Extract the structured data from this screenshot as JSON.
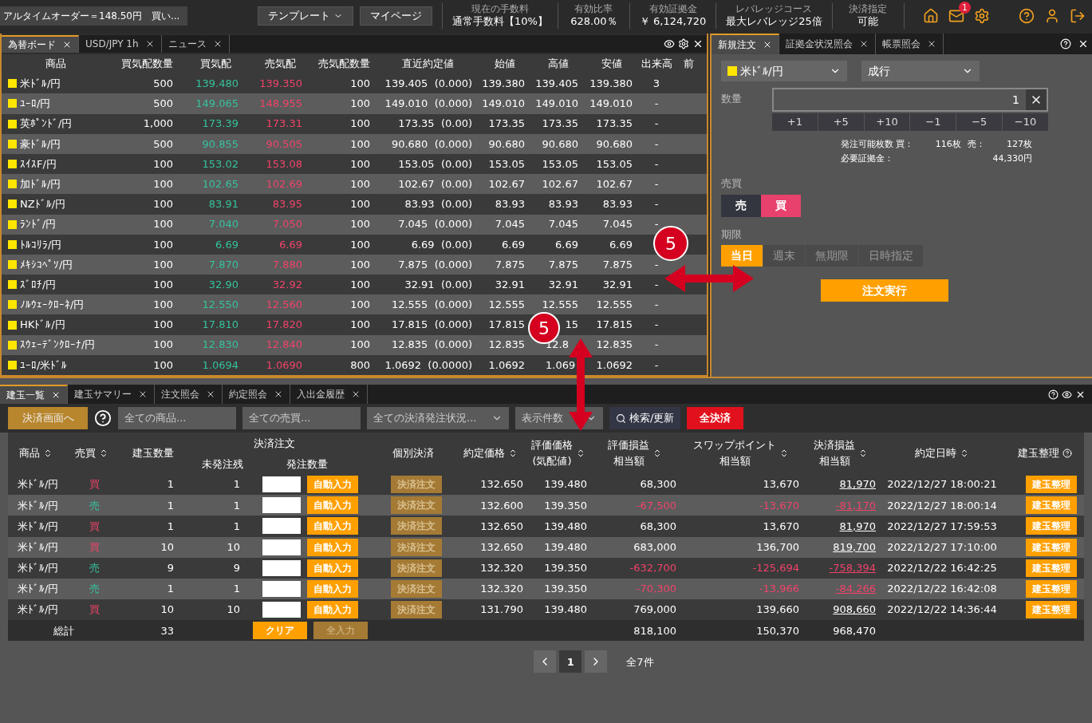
{
  "top_bar": {
    "ticker": "アルタイムオーダー＝148.50円　買い...",
    "buttons": [
      {
        "label": "テンプレート",
        "dropdown": true
      },
      {
        "label": "マイページ",
        "dropdown": false
      }
    ],
    "stats": [
      {
        "label": "現在の手数料",
        "value": "通常手数料【10%】"
      },
      {
        "label": "有効比率",
        "value": "628.00％"
      },
      {
        "label": "有効証拠金",
        "value": "￥ 6,124,720"
      },
      {
        "label": "レバレッジコース",
        "value": "最大レバレッジ25倍"
      },
      {
        "label": "決済指定",
        "value": "可能"
      }
    ],
    "mail_badge": "1"
  },
  "board": {
    "tabs": [
      {
        "label": "為替ボード",
        "selected": true
      },
      {
        "label": "USD/JPY 1h",
        "selected": false
      },
      {
        "label": "ニュース",
        "selected": false
      }
    ],
    "columns": [
      "商品",
      "買気配数量",
      "買気配",
      "売気配",
      "売気配数量",
      "直近約定値",
      "始値",
      "高値",
      "安値",
      "出来高",
      "前"
    ],
    "rows": [
      [
        "米ﾄﾞﾙ/円",
        "500",
        "139.480",
        "139.350",
        "100",
        "139.405  (0.000)",
        "139.380",
        "139.405",
        "139.380",
        "3"
      ],
      [
        "ﾕｰﾛ/円",
        "500",
        "149.065",
        "148.955",
        "100",
        "149.010  (0.000)",
        "149.010",
        "149.010",
        "149.010",
        "-"
      ],
      [
        "英ﾎﾟﾝﾄﾞ/円",
        "1,000",
        "173.39",
        "173.31",
        "100",
        "173.35  (0.00)",
        "173.35",
        "173.35",
        "173.35",
        "-"
      ],
      [
        "豪ﾄﾞﾙ/円",
        "500",
        "90.855",
        "90.505",
        "100",
        "90.680  (0.000)",
        "90.680",
        "90.680",
        "90.680",
        "-"
      ],
      [
        "ｽｲｽF/円",
        "100",
        "153.02",
        "153.08",
        "100",
        "153.05  (0.00)",
        "153.05",
        "153.05",
        "153.05",
        "-"
      ],
      [
        "加ﾄﾞﾙ/円",
        "100",
        "102.65",
        "102.69",
        "100",
        "102.67  (0.00)",
        "102.67",
        "102.67",
        "102.67",
        "-"
      ],
      [
        "NZﾄﾞﾙ/円",
        "100",
        "83.91",
        "83.95",
        "100",
        "83.93  (0.00)",
        "83.93",
        "83.93",
        "83.93",
        "-"
      ],
      [
        "ﾗﾝﾄﾞ/円",
        "100",
        "7.040",
        "7.050",
        "100",
        "7.045  (0.000)",
        "7.045",
        "7.045",
        "7.045",
        "-"
      ],
      [
        "ﾄﾙｺﾘﾗ/円",
        "100",
        "6.69",
        "6.69",
        "100",
        "6.69  (0.00)",
        "6.69",
        "6.69",
        "6.69"
      ],
      [
        "ﾒｷｼｺﾍﾟｿ/円",
        "100",
        "7.870",
        "7.880",
        "100",
        "7.875  (0.000)",
        "7.875",
        "7.875",
        "7.875",
        "-"
      ],
      [
        "ｽﾞﾛﾁ/円",
        "100",
        "32.90",
        "32.92",
        "100",
        "32.91  (0.00)",
        "32.91",
        "32.91",
        "32.91",
        "-"
      ],
      [
        "ﾉﾙｳｪｰｸﾛｰﾈ/円",
        "100",
        "12.550",
        "12.560",
        "100",
        "12.555  (0.000)",
        "12.555",
        "12.555",
        "12.555",
        "-"
      ],
      [
        "HKﾄﾞﾙ/円",
        "100",
        "17.810",
        "17.820",
        "100",
        "17.815  (0.000)",
        "17.815",
        {
          "text": "15",
          "kind": "tail"
        },
        "17.815",
        "-"
      ],
      [
        "ｽｳｪｰﾃﾞﾝｸﾛｰﾅ/円",
        "100",
        "12.830",
        "12.840",
        "100",
        "12.835  (0.000)",
        "12.835",
        {
          "text": "12.8",
          "kind": "head"
        },
        "12.835",
        "-"
      ],
      [
        "ﾕｰﾛ/米ﾄﾞﾙ",
        "100",
        "1.0694",
        "1.0690",
        "800",
        "1.0692  (0.0000)",
        "1.0692",
        {
          "text": "1.069",
          "kind": "head"
        },
        "1.0692",
        "-"
      ]
    ]
  },
  "order": {
    "tabs": [
      {
        "label": "新規注文",
        "selected": true
      },
      {
        "label": "証拠金状況照会",
        "selected": false
      },
      {
        "label": "帳票照会",
        "selected": false
      }
    ],
    "pair": "米ﾄﾞﾙ/円",
    "order_type": "成行",
    "quantity_label": "数量",
    "quantity": "1",
    "steps": [
      "+1",
      "+5",
      "+10",
      "−1",
      "−5",
      "−10"
    ],
    "info": [
      {
        "label": "発注可能枚数 買：",
        "value": "116枚",
        "label2": "売：",
        "value2": "127枚"
      },
      {
        "label": "必要証拠金：",
        "value": "44,330円"
      }
    ],
    "side_label": "売買",
    "sides": [
      {
        "label": "売",
        "selected": false,
        "kind": "sell"
      },
      {
        "label": "買",
        "selected": true,
        "kind": "buy"
      }
    ],
    "term_label": "期限",
    "terms": [
      {
        "label": "当日",
        "selected": true
      },
      {
        "label": "週末",
        "selected": false
      },
      {
        "label": "無期限",
        "selected": false
      },
      {
        "label": "日時指定",
        "selected": false
      }
    ],
    "submit": "注文実行"
  },
  "positions": {
    "tabs": [
      {
        "label": "建玉一覧",
        "selected": true
      },
      {
        "label": "建玉サマリー",
        "selected": false
      },
      {
        "label": "注文照会",
        "selected": false
      },
      {
        "label": "約定照会",
        "selected": false
      },
      {
        "label": "入出金履歴",
        "selected": false
      }
    ],
    "settle_button": "決済画面へ",
    "filters": [
      {
        "placeholder": "全ての商品...",
        "dropdown": false
      },
      {
        "placeholder": "全ての売買...",
        "dropdown": false
      },
      {
        "placeholder": "全ての決済発注状況...",
        "dropdown": true
      },
      {
        "placeholder": "表示件数",
        "dropdown": true
      }
    ],
    "search_button": "検索/更新",
    "close_all": "全決済",
    "group_header": "決済注文",
    "columns": [
      {
        "label": "商品",
        "sortable": true
      },
      {
        "label": "売買",
        "sortable": true
      },
      {
        "label": "建玉数量",
        "sortable": false
      },
      {
        "label": "未発注残",
        "sortable": false
      },
      {
        "label": "発注数量",
        "sortable": false
      },
      {
        "label": "個別決済",
        "sortable": false
      },
      {
        "label": "約定価格",
        "sortable": true
      },
      {
        "label": [
          "評価価格",
          "(気配値)"
        ],
        "sortable": true
      },
      {
        "label": [
          "評価損益",
          "相当額"
        ],
        "sortable": true
      },
      {
        "label": [
          "スワップポイント",
          "相当額"
        ],
        "sortable": true
      },
      {
        "label": [
          "決済損益",
          "相当額"
        ],
        "sortable": true
      },
      {
        "label": "約定日時",
        "sortable": true
      },
      {
        "label": "建玉整理",
        "sortable": false,
        "help": true
      }
    ],
    "rows": [
      {
        "product": "米ﾄﾞﾙ/円",
        "side": "買",
        "kind": "buy",
        "qty": "1",
        "unfilled": "1",
        "auto": "自動入力",
        "settle": "決済注文",
        "settle_disabled": true,
        "price": "132.650",
        "eval": "139.480",
        "pnl": "68,300",
        "swap": "13,670",
        "realized": "81,970",
        "loss": false,
        "date": "2022/12/27 18:00:21",
        "action": "建玉整理"
      },
      {
        "product": "米ﾄﾞﾙ/円",
        "side": "売",
        "kind": "sell",
        "qty": "1",
        "unfilled": "1",
        "auto": "自動入力",
        "settle": "決済注文",
        "settle_disabled": true,
        "price": "132.600",
        "eval": "139.350",
        "pnl": "-67,500",
        "swap": "-13,670",
        "realized": "-81,170",
        "loss": true,
        "date": "2022/12/27 18:00:14",
        "action": "建玉整理"
      },
      {
        "product": "米ﾄﾞﾙ/円",
        "side": "買",
        "kind": "buy",
        "qty": "1",
        "unfilled": "1",
        "auto": "自動入力",
        "settle": "決済注文",
        "settle_disabled": true,
        "price": "132.650",
        "eval": "139.480",
        "pnl": "68,300",
        "swap": "13,670",
        "realized": "81,970",
        "loss": false,
        "date": "2022/12/27 17:59:53",
        "action": "建玉整理"
      },
      {
        "product": "米ﾄﾞﾙ/円",
        "side": "買",
        "kind": "buy",
        "qty": "10",
        "unfilled": "10",
        "auto": "自動入力",
        "settle": "決済注文",
        "settle_disabled": true,
        "price": "132.650",
        "eval": "139.480",
        "pnl": "683,000",
        "swap": "136,700",
        "realized": "819,700",
        "loss": false,
        "date": "2022/12/27 17:10:00",
        "action": "建玉整理"
      },
      {
        "product": "米ﾄﾞﾙ/円",
        "side": "売",
        "kind": "sell",
        "qty": "9",
        "unfilled": "9",
        "auto": "自動入力",
        "settle": "決済注文",
        "settle_disabled": true,
        "price": "132.320",
        "eval": "139.350",
        "pnl": "-632,700",
        "swap": "-125,694",
        "realized": "-758,394",
        "loss": true,
        "date": "2022/12/22 16:42:25",
        "action": "建玉整理"
      },
      {
        "product": "米ﾄﾞﾙ/円",
        "side": "売",
        "kind": "sell",
        "qty": "1",
        "unfilled": "1",
        "auto": "自動入力",
        "settle": "決済注文",
        "settle_disabled": true,
        "price": "132.320",
        "eval": "139.350",
        "pnl": "-70,300",
        "swap": "-13,966",
        "realized": "-84,266",
        "loss": true,
        "date": "2022/12/22 16:42:08",
        "action": "建玉整理"
      },
      {
        "product": "米ﾄﾞﾙ/円",
        "side": "買",
        "kind": "buy",
        "qty": "10",
        "unfilled": "10",
        "auto": "自動入力",
        "settle": "決済注文",
        "settle_disabled": true,
        "price": "131.790",
        "eval": "139.480",
        "pnl": "769,000",
        "swap": "139,660",
        "realized": "908,660",
        "loss": false,
        "date": "2022/12/22 14:36:44",
        "action": "建玉整理"
      }
    ],
    "total": {
      "label": "総計",
      "qty": "33",
      "clear": "クリア",
      "fill_all": "全入力",
      "pnl": "818,100",
      "swap": "150,370",
      "realized": "968,470"
    },
    "pagination": {
      "page": "1",
      "count": "全7件"
    }
  },
  "annotations": [
    {
      "label": "5"
    },
    {
      "label": "5"
    }
  ]
}
